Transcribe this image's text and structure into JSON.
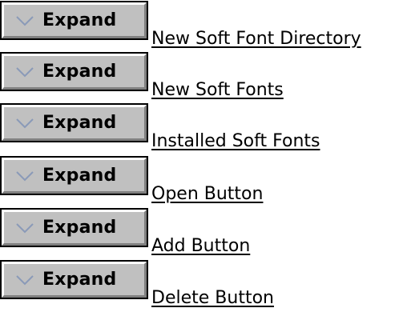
{
  "expand_label": "Expand",
  "icons": {
    "expand": "chevron-down-icon"
  },
  "colors": {
    "button_face": "#c0c0c0",
    "chevron": "#8a9ab8",
    "text": "#000000"
  },
  "topics": [
    {
      "label": "New Soft Font Directory"
    },
    {
      "label": "New Soft Fonts"
    },
    {
      "label": "Installed Soft Fonts"
    },
    {
      "label": "Open Button"
    },
    {
      "label": "Add Button"
    },
    {
      "label": "Delete Button"
    }
  ]
}
